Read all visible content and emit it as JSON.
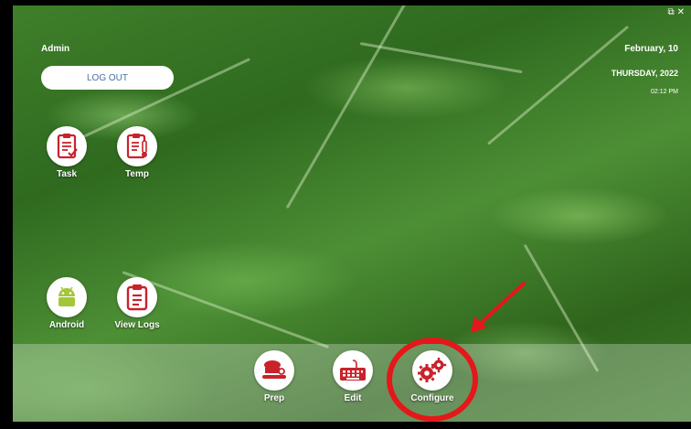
{
  "window": {
    "controls": "⧉✕"
  },
  "user": {
    "name": "Admin",
    "logout_label": "LOG OUT"
  },
  "datetime": {
    "date": "February, 10",
    "weekday_year": "THURSDAY, 2022",
    "time": "02:12 PM"
  },
  "apps": [
    {
      "label": "Task",
      "icon": "clipboard-check-icon"
    },
    {
      "label": "Temp",
      "icon": "clipboard-thermometer-icon"
    },
    {
      "label": "Android",
      "icon": "android-icon"
    },
    {
      "label": "View Logs",
      "icon": "clipboard-list-icon"
    }
  ],
  "dock": [
    {
      "label": "Prep",
      "icon": "food-prep-icon"
    },
    {
      "label": "Edit",
      "icon": "keyboard-icon"
    },
    {
      "label": "Configure",
      "icon": "gears-icon"
    }
  ],
  "colors": {
    "brand_red": "#c8232b",
    "annotation_red": "#e4171b",
    "logout_text": "#4a6fa5"
  }
}
